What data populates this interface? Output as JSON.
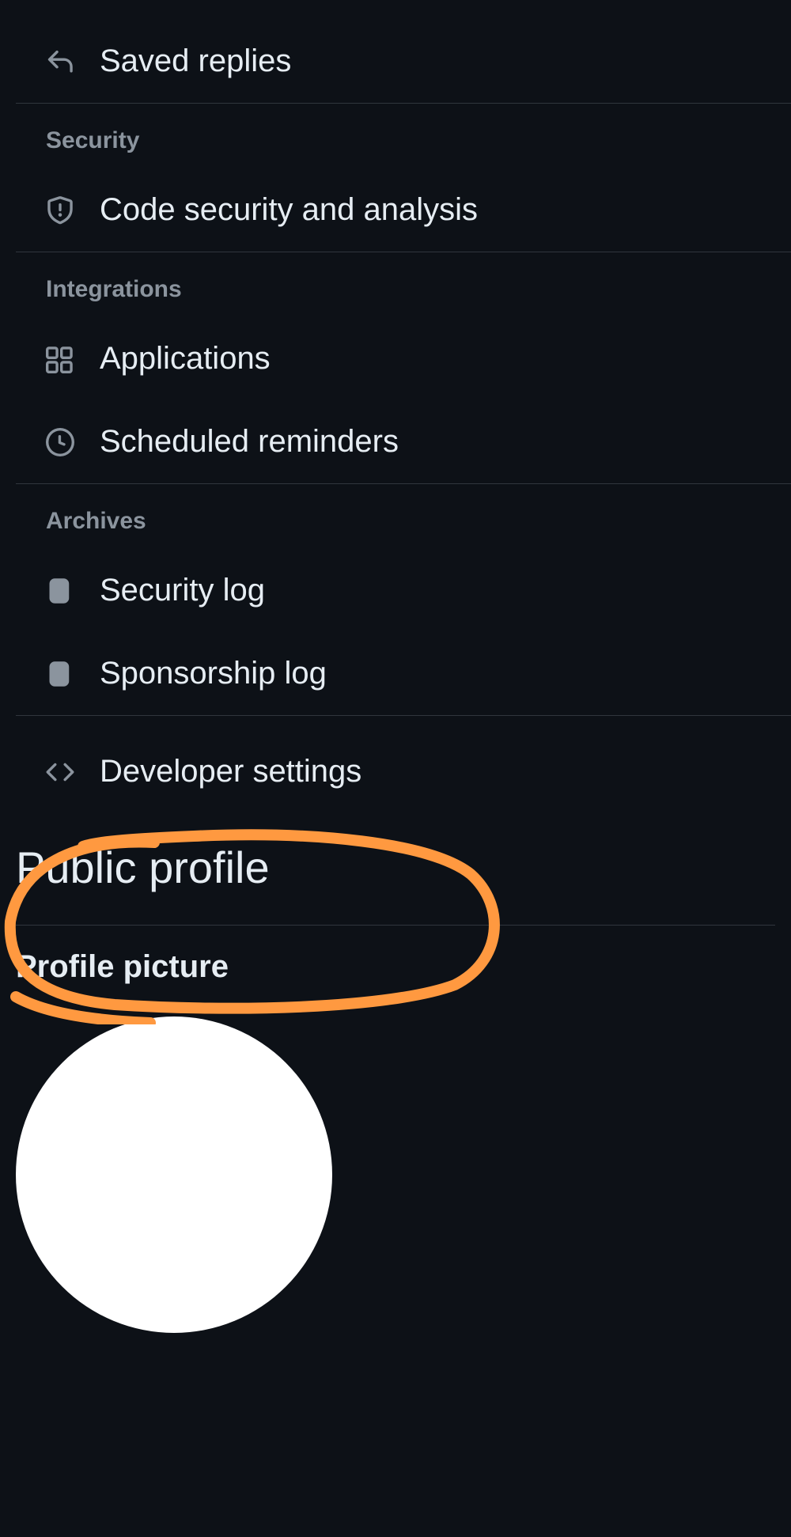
{
  "nav": {
    "saved_replies": "Saved replies",
    "security_header": "Security",
    "code_security": "Code security and analysis",
    "integrations_header": "Integrations",
    "applications": "Applications",
    "scheduled_reminders": "Scheduled reminders",
    "archives_header": "Archives",
    "security_log": "Security log",
    "sponsorship_log": "Sponsorship log",
    "developer_settings": "Developer settings"
  },
  "page": {
    "title": "Public profile",
    "profile_picture_heading": "Profile picture"
  },
  "annotation": {
    "highlighted_item": "developer_settings",
    "color": "#ff9940"
  }
}
